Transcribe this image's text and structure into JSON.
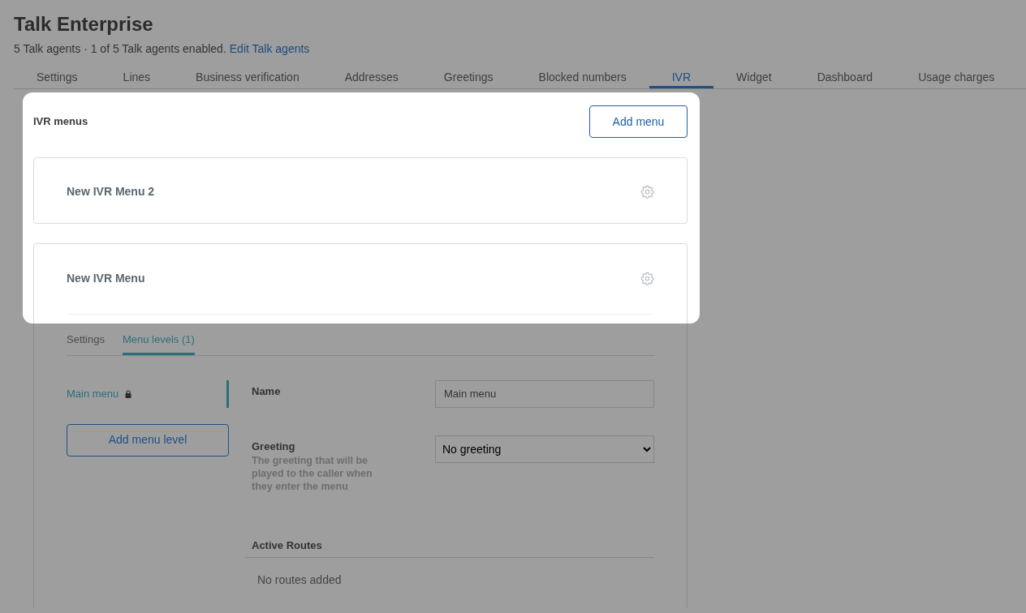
{
  "header": {
    "title": "Talk Enterprise",
    "subtitle": "5 Talk agents · 1 of 5 Talk agents enabled.",
    "link": "Edit Talk agents"
  },
  "tabs": [
    {
      "label": "Settings",
      "selected": false
    },
    {
      "label": "Lines",
      "selected": false
    },
    {
      "label": "Business verification",
      "selected": false
    },
    {
      "label": "Addresses",
      "selected": false
    },
    {
      "label": "Greetings",
      "selected": false
    },
    {
      "label": "Blocked numbers",
      "selected": false
    },
    {
      "label": "IVR",
      "selected": true
    },
    {
      "label": "Widget",
      "selected": false
    },
    {
      "label": "Dashboard",
      "selected": false
    },
    {
      "label": "Usage charges",
      "selected": false
    }
  ],
  "ivr_menus": {
    "title": "IVR menus",
    "add_button": "Add menu",
    "menus": [
      {
        "name": "New IVR Menu 2"
      },
      {
        "name": "New IVR Menu",
        "detail": {
          "tabs": [
            {
              "label": "Settings",
              "selected": false
            },
            {
              "label": "Menu levels (1)",
              "selected": true
            }
          ],
          "levels": [
            {
              "name": "Main menu",
              "locked": true,
              "selected": true
            }
          ],
          "add_level_button": "Add menu level",
          "fields": [
            {
              "kind": "text",
              "label": "Name",
              "value": "Main menu"
            },
            {
              "kind": "select",
              "label": "Greeting",
              "description": "The greeting that will be played to the caller when they enter the menu",
              "value": "No greeting"
            }
          ],
          "routes": {
            "title": "Active Routes",
            "empty": "No routes added"
          }
        }
      }
    ]
  }
}
